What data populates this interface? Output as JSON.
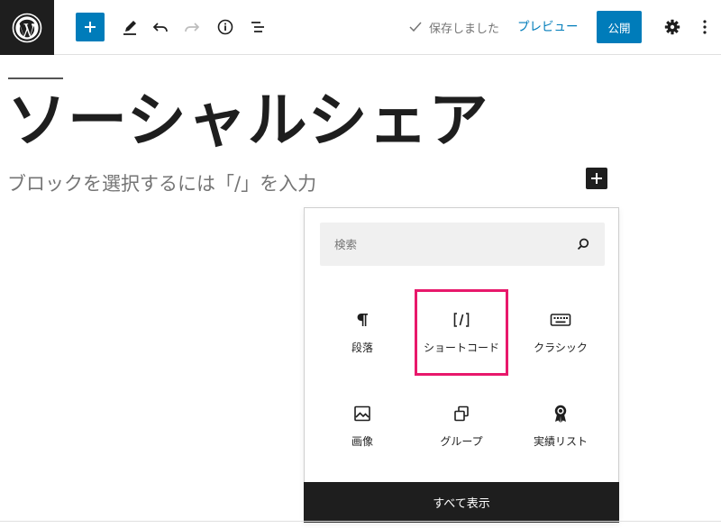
{
  "toolbar": {
    "saved_label": "保存しました",
    "preview_label": "プレビュー",
    "publish_label": "公開"
  },
  "editor": {
    "post_title": "ソーシャルシェア",
    "block_placeholder": "ブロックを選択するには「/」を入力"
  },
  "quick_inserter": {
    "search_placeholder": "検索",
    "blocks": [
      {
        "label": "段落",
        "icon": "paragraph-icon"
      },
      {
        "label": "ショートコード",
        "icon": "shortcode-icon"
      },
      {
        "label": "クラシック",
        "icon": "keyboard-icon"
      },
      {
        "label": "画像",
        "icon": "image-icon"
      },
      {
        "label": "グループ",
        "icon": "group-icon"
      },
      {
        "label": "実績リスト",
        "icon": "award-icon"
      }
    ],
    "highlighted_block": "ショートコード",
    "show_all_label": "すべて表示"
  },
  "colors": {
    "accent": "#007cba",
    "dark": "#1e1e1e",
    "highlight": "#e8186b",
    "muted_text": "#757575"
  }
}
